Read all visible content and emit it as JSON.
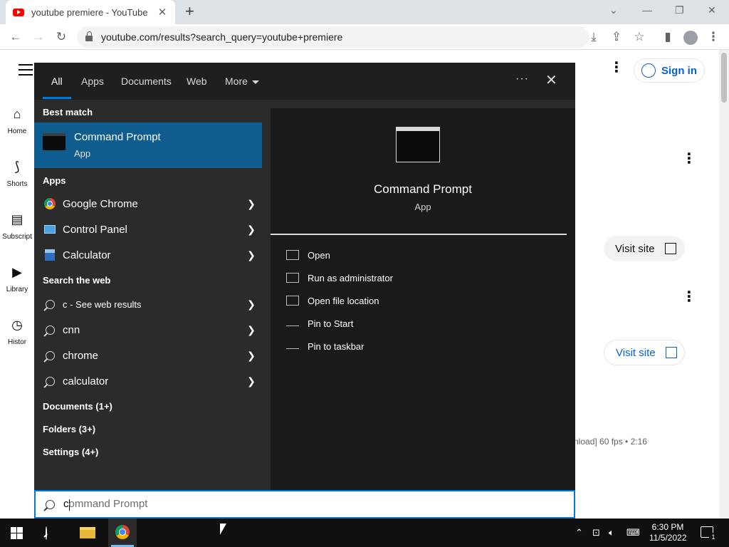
{
  "browser": {
    "tab_title": "youtube premiere - YouTube",
    "url": "youtube.com/results?search_query=youtube+premiere"
  },
  "youtube": {
    "sidebar": [
      {
        "label": "Home"
      },
      {
        "label": "Shorts"
      },
      {
        "label": "Subscript"
      },
      {
        "label": "Library"
      },
      {
        "label": "Histor"
      }
    ],
    "sign_in": "Sign in",
    "visit_site_1": "Visit site",
    "visit_site_2": "Visit site",
    "video_meta": "nload] 60 fps • 2:16"
  },
  "start_search": {
    "tabs": [
      "All",
      "Apps",
      "Documents",
      "Web",
      "More"
    ],
    "best_match_header": "Best match",
    "best_match": {
      "title": "Command Prompt",
      "subtitle": "App"
    },
    "apps_header": "Apps",
    "apps": [
      "Google Chrome",
      "Control Panel",
      "Calculator"
    ],
    "web_header": "Search the web",
    "web_results": [
      "c - See web results",
      "cnn",
      "chrome",
      "calculator"
    ],
    "documents": "Documents (1+)",
    "folders": "Folders (3+)",
    "settings": "Settings (4+)",
    "preview": {
      "title": "Command Prompt",
      "subtitle": "App",
      "actions": [
        "Open",
        "Run as administrator",
        "Open file location",
        "Pin to Start",
        "Pin to taskbar"
      ]
    },
    "search_typed": "c",
    "search_suggestion": "ommand Prompt"
  },
  "taskbar": {
    "time": "6:30 PM",
    "date": "11/5/2022",
    "notification_count": "1"
  },
  "colors": {
    "accent": "#0078d7",
    "best_match_bg": "#0f5c8f",
    "youtube_blue": "#065fd4"
  }
}
